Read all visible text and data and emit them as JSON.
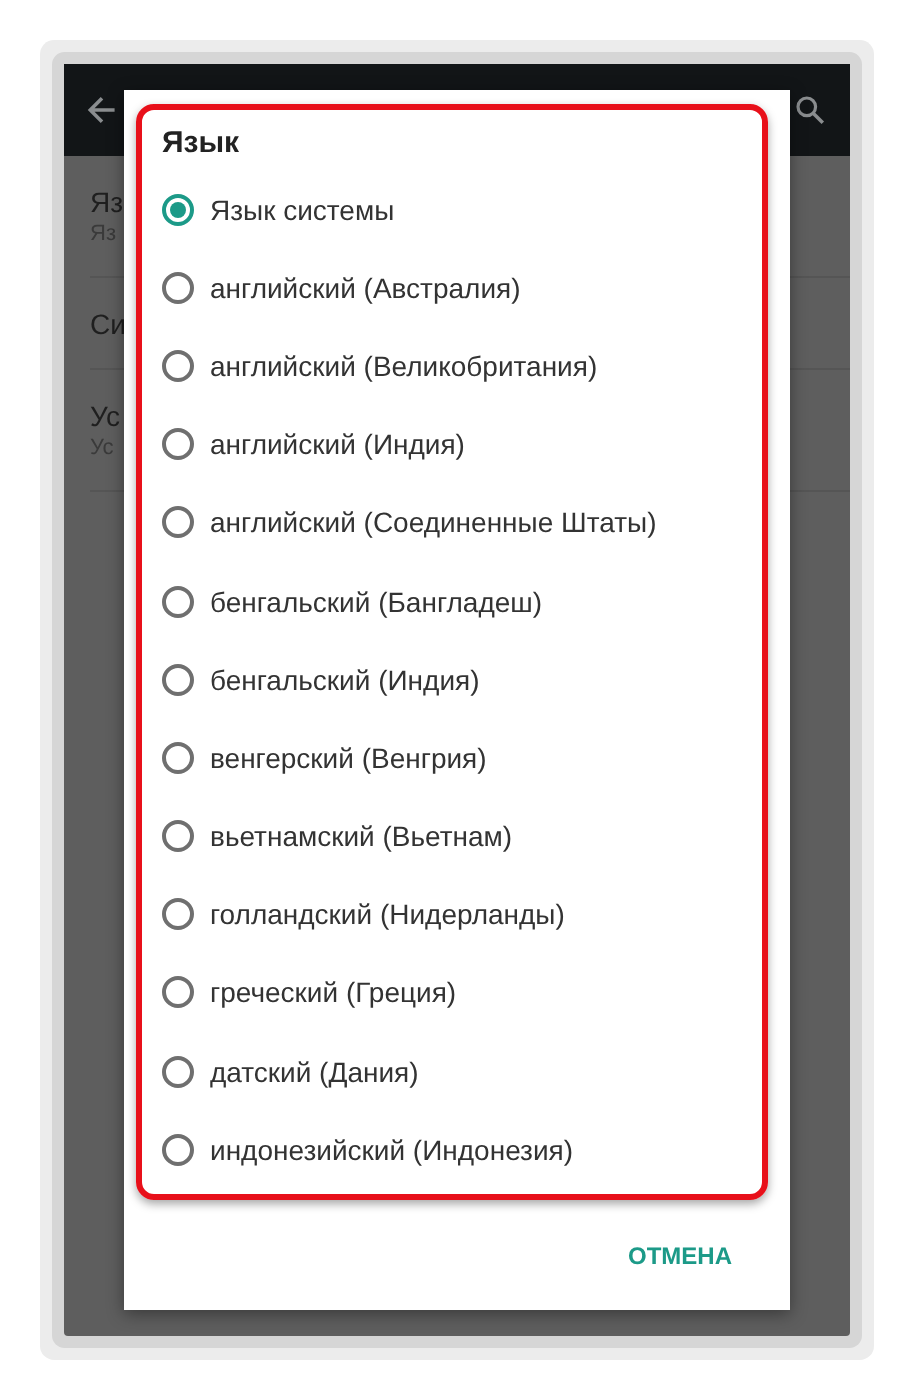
{
  "background": {
    "items": [
      {
        "title": "Яз",
        "subtitle": "Яз"
      },
      {
        "title": "Си"
      },
      {
        "title": "Ус",
        "subtitle": "Ус"
      }
    ]
  },
  "dialog": {
    "title": "Язык",
    "options": [
      {
        "label": "Язык системы",
        "selected": true
      },
      {
        "label": "английский (Австралия)",
        "selected": false
      },
      {
        "label": "английский (Великобритания)",
        "selected": false
      },
      {
        "label": "английский (Индия)",
        "selected": false
      },
      {
        "label": "английский (Соединенные Штаты)",
        "selected": false
      },
      {
        "label": "бенгальский (Бангладеш)",
        "selected": false
      },
      {
        "label": "бенгальский (Индия)",
        "selected": false
      },
      {
        "label": "венгерский (Венгрия)",
        "selected": false
      },
      {
        "label": "вьетнамский (Вьетнам)",
        "selected": false
      },
      {
        "label": "голландский (Нидерланды)",
        "selected": false
      },
      {
        "label": "греческий (Греция)",
        "selected": false
      },
      {
        "label": "датский (Дания)",
        "selected": false
      },
      {
        "label": "индонезийский (Индонезия)",
        "selected": false
      }
    ],
    "cancel": "ОТМЕНА"
  }
}
